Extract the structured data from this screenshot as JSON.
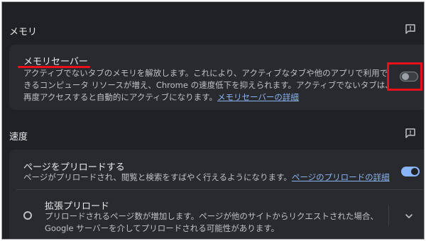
{
  "memory": {
    "section_title": "メモリ",
    "saver": {
      "title": "メモリセーバー",
      "desc_line1": "アクティブでないタブのメモリを解放します。これにより、アクティブなタブや他のアプリで利用で",
      "desc_line2": "きるコンピュータ リソースが増え、Chrome の速度低下を抑えられます。アクティブでないタブは、",
      "desc_line3": "再度アクセスすると自動的にアクティブになります。",
      "link": "メモリセーバーの詳細",
      "enabled": false
    }
  },
  "speed": {
    "section_title": "速度",
    "preload": {
      "title": "ページをプリロードする",
      "desc": "ページがプリロードされ、閲覧と検索をすばやく行えるようになります。",
      "link": "ページのプリロードの詳細",
      "enabled": true
    },
    "extended": {
      "title": "拡張プリロード",
      "desc_line1": "プリロードされるページ数が増加します。ページが他のサイトからリクエストされた場合、",
      "desc_line2": "Google サーバーを介してプリロードされる可能性があります。"
    }
  },
  "annotation_color": "#e8101a",
  "icons": [
    "feedback-icon",
    "chevron-down-icon"
  ]
}
